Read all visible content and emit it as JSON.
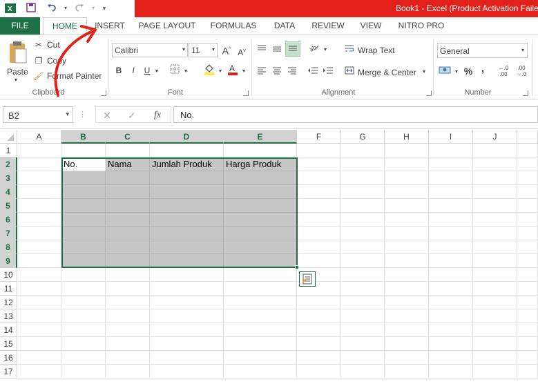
{
  "window": {
    "title": "Book1 -  Excel (Product Activation Faile"
  },
  "qat": {
    "icons": [
      "excel-logo-icon",
      "save-icon",
      "undo-icon",
      "redo-icon",
      "customize-icon"
    ]
  },
  "tabs": [
    "FILE",
    "HOME",
    "INSERT",
    "PAGE LAYOUT",
    "FORMULAS",
    "DATA",
    "REVIEW",
    "VIEW",
    "NITRO PRO"
  ],
  "active_tab": "HOME",
  "ribbon": {
    "clipboard": {
      "paste": "Paste",
      "cut": "Cut",
      "copy": "Copy",
      "format_painter": "Format Painter",
      "label": "Clipboard"
    },
    "font": {
      "family": "Calibri",
      "size": "11",
      "bold": "B",
      "italic": "I",
      "underline": "U",
      "label": "Font"
    },
    "alignment": {
      "wrap_text": "Wrap Text",
      "merge_center": "Merge & Center",
      "label": "Alignment"
    },
    "number": {
      "format": "General",
      "percent": "%",
      "comma": ",",
      "label": "Number"
    }
  },
  "formula_bar": {
    "name_box": "B2",
    "fx": "fx",
    "content": "No."
  },
  "grid": {
    "columns": [
      "A",
      "B",
      "C",
      "D",
      "E",
      "F",
      "G",
      "H",
      "I",
      "J"
    ],
    "selected_columns": [
      "B",
      "C",
      "D",
      "E"
    ],
    "rows": [
      "1",
      "2",
      "3",
      "4",
      "5",
      "6",
      "7",
      "8",
      "9",
      "10",
      "11",
      "12",
      "13",
      "14",
      "15",
      "16",
      "17"
    ],
    "selected_rows": [
      "2",
      "3",
      "4",
      "5",
      "6",
      "7",
      "8",
      "9"
    ],
    "headers": {
      "B2": "No.",
      "C2": "Nama",
      "D2": "Jumlah Produk",
      "E2": "Harga Produk"
    }
  },
  "colors": {
    "excel_green": "#1e7145",
    "title_red": "#e1211a",
    "selection_gray": "#c6c6c6"
  }
}
